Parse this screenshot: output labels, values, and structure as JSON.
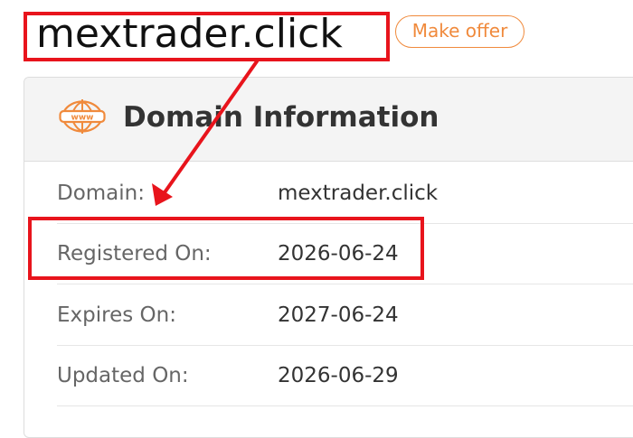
{
  "header": {
    "domain_name": "mextrader.click",
    "make_offer_label": "Make offer"
  },
  "card": {
    "title": "Domain Information",
    "icon": "www-icon",
    "rows": [
      {
        "label": "Domain:",
        "value": "mextrader.click"
      },
      {
        "label": "Registered On:",
        "value": "2026-06-24"
      },
      {
        "label": "Expires On:",
        "value": "2027-06-24"
      },
      {
        "label": "Updated On:",
        "value": "2026-06-29"
      }
    ]
  },
  "annotations": {
    "highlight_color": "#e8141c",
    "arrow_from": "domain-name-highlight",
    "arrow_to": "registered-on-highlight"
  },
  "colors": {
    "accent": "#f08a3c",
    "text_dark": "#333333",
    "text_label": "#666666",
    "annotation_red": "#e8141c"
  }
}
